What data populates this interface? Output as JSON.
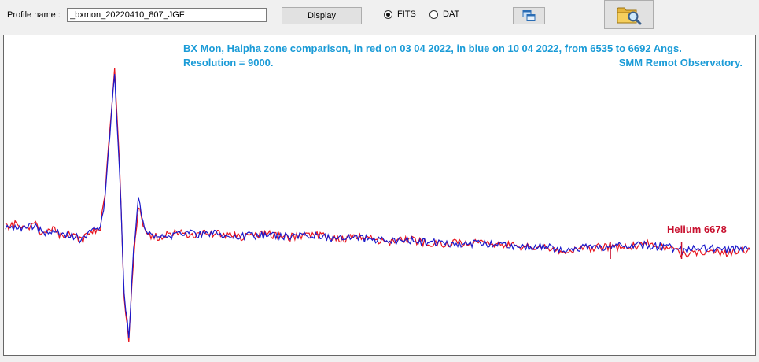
{
  "toolbar": {
    "profile_label": "Profile name :",
    "profile_value": "_bxmon_20220410_807_JGF",
    "display_label": "Display",
    "format_options": [
      {
        "label": "FITS",
        "selected": true
      },
      {
        "label": "DAT",
        "selected": false
      }
    ],
    "copy_icon": "copy-windows-icon",
    "open_icon": "folder-search-icon"
  },
  "chart_data": {
    "type": "line",
    "title_line1": "BX Mon, Halpha zone comparison, in red on 03 04 2022, in blue on 10 04 2022, from 6535 to 6692 Angs.",
    "title_line2_left": "Resolution = 9000.",
    "title_line2_right": "SMM Remot Observatory.",
    "annotation": "Helium 6678",
    "annotation_color": "#c8102e",
    "caption_color": "#1a9bd7",
    "x_range": [
      6535,
      6692
    ],
    "axes_visible": false,
    "grid": false,
    "series": [
      {
        "color": "#e8141e",
        "x": [
          6535,
          6537,
          6539,
          6541,
          6543,
          6545,
          6547,
          6549,
          6551,
          6553,
          6555,
          6556,
          6557,
          6558,
          6559,
          6560,
          6561,
          6562,
          6563,
          6564,
          6565,
          6567,
          6569,
          6572,
          6575,
          6580,
          6585,
          6590,
          6595,
          6600,
          6605,
          6610,
          6615,
          6620,
          6625,
          6630,
          6635,
          6640,
          6645,
          6650,
          6653,
          6655,
          6657,
          6660,
          6665,
          6670,
          6675,
          6678,
          6680,
          6683,
          6686,
          6689,
          6692
        ],
        "y": [
          1.02,
          1.04,
          1.0,
          1.05,
          0.95,
          1.0,
          0.92,
          0.96,
          0.9,
          0.98,
          1.02,
          1.3,
          1.9,
          2.4,
          1.6,
          0.4,
          0.0,
          0.75,
          1.2,
          1.05,
          0.95,
          0.93,
          0.95,
          0.97,
          0.95,
          0.97,
          0.93,
          0.96,
          0.93,
          0.95,
          0.91,
          0.93,
          0.89,
          0.91,
          0.87,
          0.88,
          0.88,
          0.86,
          0.84,
          0.83,
          0.78,
          0.82,
          0.83,
          0.84,
          0.84,
          0.87,
          0.82,
          0.78,
          0.8,
          0.81,
          0.79,
          0.8,
          0.82
        ]
      },
      {
        "color": "#1a1acc",
        "x": [
          6535,
          6537,
          6539,
          6541,
          6543,
          6545,
          6547,
          6549,
          6551,
          6553,
          6555,
          6556,
          6557,
          6558,
          6559,
          6560,
          6561,
          6562,
          6563,
          6564,
          6565,
          6567,
          6569,
          6572,
          6575,
          6580,
          6585,
          6590,
          6595,
          6600,
          6605,
          6610,
          6615,
          6620,
          6625,
          6630,
          6635,
          6640,
          6645,
          6650,
          6653,
          6655,
          6657,
          6660,
          6665,
          6670,
          6675,
          6678,
          6680,
          6683,
          6686,
          6689,
          6692
        ],
        "y": [
          1.03,
          1.02,
          1.02,
          1.03,
          0.97,
          0.99,
          0.94,
          0.95,
          0.91,
          0.97,
          1.01,
          1.28,
          1.85,
          2.35,
          1.55,
          0.45,
          0.05,
          0.8,
          1.25,
          1.07,
          0.97,
          0.95,
          0.94,
          0.96,
          0.96,
          0.96,
          0.94,
          0.95,
          0.94,
          0.94,
          0.92,
          0.92,
          0.9,
          0.9,
          0.88,
          0.87,
          0.87,
          0.86,
          0.85,
          0.84,
          0.81,
          0.83,
          0.84,
          0.84,
          0.85,
          0.86,
          0.84,
          0.81,
          0.82,
          0.83,
          0.82,
          0.83,
          0.82
        ]
      }
    ]
  }
}
